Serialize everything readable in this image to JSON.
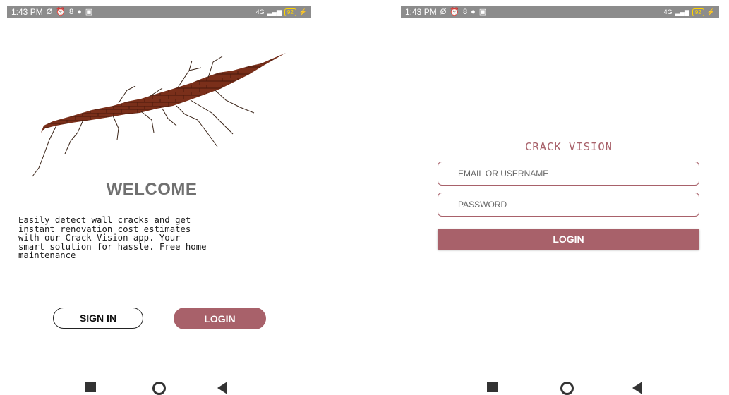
{
  "status_bar": {
    "time": "1:43 PM",
    "left_glyphs": [
      "Ø",
      "⏰",
      "8",
      "●",
      "▣"
    ],
    "network": "4G",
    "battery": "92"
  },
  "welcome_screen": {
    "title": "WELCOME",
    "description": "Easily detect wall cracks and get\ninstant renovation cost estimates\nwith our Crack Vision app. Your\nsmart solution for hassle. Free home\nmaintenance",
    "signin_label": "SIGN IN",
    "login_label": "LOGIN"
  },
  "login_screen": {
    "app_title": "CRACK VISION",
    "email_placeholder": "EMAIL OR USERNAME",
    "password_placeholder": "PASSWORD",
    "login_label": "LOGIN"
  },
  "colors": {
    "accent": "#a8616a",
    "status_bar": "#8c8c8c",
    "crack_fill": "#6e2a16",
    "brick": "#8a3a22"
  },
  "icons": {
    "nav": [
      "recent-apps-icon",
      "home-icon",
      "back-icon"
    ]
  }
}
